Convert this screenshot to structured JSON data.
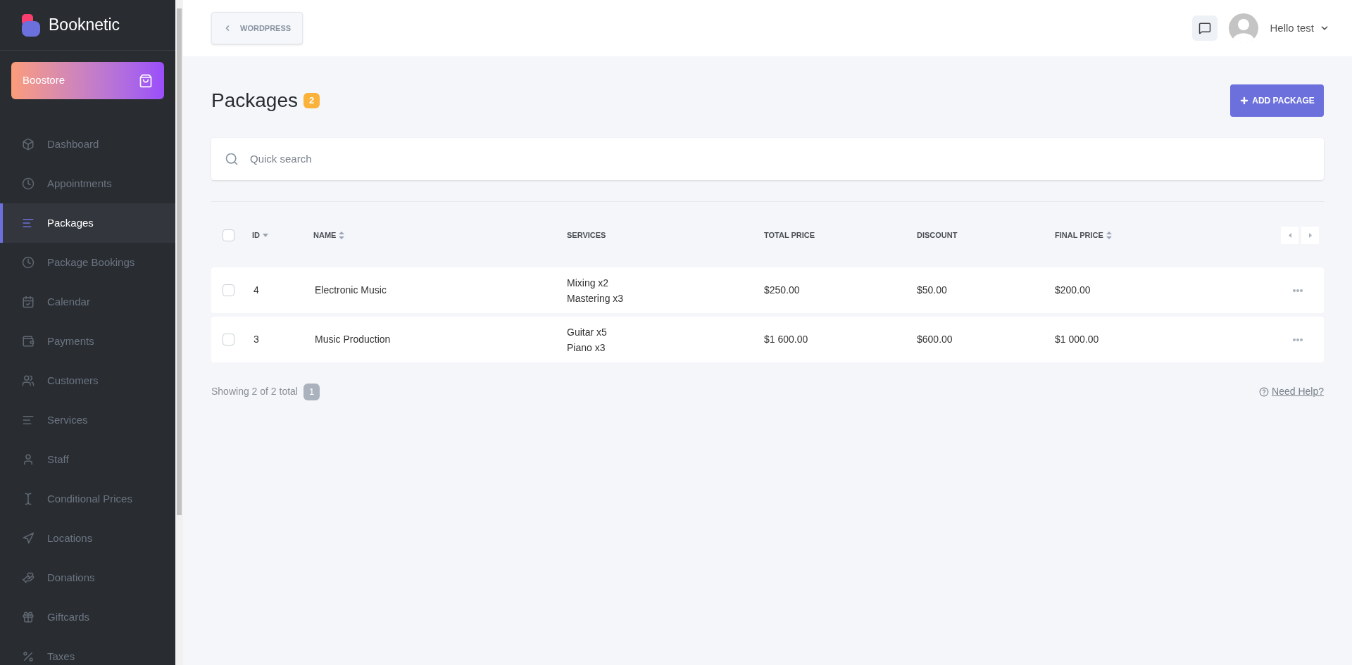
{
  "brand": "Booknetic",
  "boostore": "Boostore",
  "sidebar": {
    "items": [
      {
        "label": "Dashboard",
        "selected": false
      },
      {
        "label": "Appointments",
        "selected": false
      },
      {
        "label": "Packages",
        "selected": true
      },
      {
        "label": "Package Bookings",
        "selected": false
      },
      {
        "label": "Calendar",
        "selected": false
      },
      {
        "label": "Payments",
        "selected": false
      },
      {
        "label": "Customers",
        "selected": false
      },
      {
        "label": "Services",
        "selected": false
      },
      {
        "label": "Staff",
        "selected": false
      },
      {
        "label": "Conditional Prices",
        "selected": false
      },
      {
        "label": "Locations",
        "selected": false
      },
      {
        "label": "Donations",
        "selected": false
      },
      {
        "label": "Giftcards",
        "selected": false
      },
      {
        "label": "Taxes",
        "selected": false
      }
    ]
  },
  "header": {
    "back_button": "WORDPRESS",
    "user": "Hello test"
  },
  "page": {
    "title": "Packages",
    "count": "2",
    "add_button": "ADD PACKAGE"
  },
  "search": {
    "placeholder": "Quick search"
  },
  "table": {
    "all_checked": false,
    "columns": [
      {
        "label": "ID",
        "kind": "sorted"
      },
      {
        "label": "NAME",
        "kind": "sortable"
      },
      {
        "label": "SERVICES",
        "kind": "plain"
      },
      {
        "label": "TOTAL PRICE",
        "kind": "plain"
      },
      {
        "label": "DISCOUNT",
        "kind": "plain"
      },
      {
        "label": "FINAL PRICE",
        "kind": "sortable"
      }
    ],
    "rows": [
      {
        "checked": false,
        "id": "4",
        "name": "Electronic Music",
        "services": [
          "Mixing x2",
          "Mastering x3"
        ],
        "total": "$250.00",
        "discount": "$50.00",
        "final": "$200.00"
      },
      {
        "checked": false,
        "id": "3",
        "name": "Music Production",
        "services": [
          "Guitar x5",
          "Piano x3"
        ],
        "total": "$1 600.00",
        "discount": "$600.00",
        "final": "$1 000.00"
      }
    ]
  },
  "footer": {
    "showing": "Showing 2 of 2 total",
    "page": "1",
    "help": "Need Help?"
  }
}
